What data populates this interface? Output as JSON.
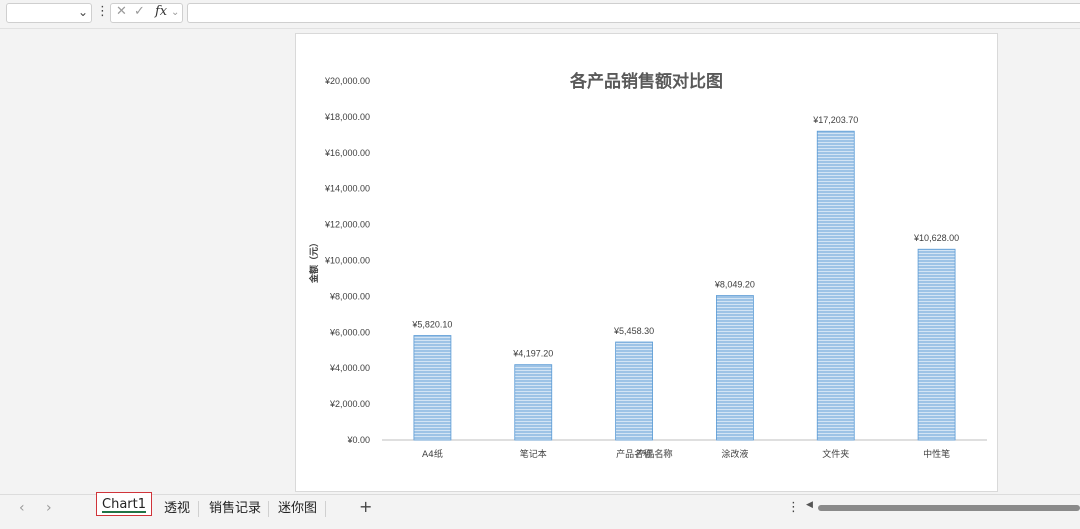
{
  "formula_bar": {
    "name_box_value": "",
    "formula_value": "",
    "fx_label": "fx"
  },
  "chart_data": {
    "type": "bar",
    "title": "各产品销售额对比图",
    "xlabel": "产品名称",
    "ylabel": "金额（元）",
    "categories": [
      "A4纸",
      "笔记本",
      "产品名称",
      "涂改液",
      "文件夹",
      "中性笔"
    ],
    "values": [
      5820.1,
      4197.2,
      5458.3,
      8049.2,
      17203.7,
      10628.0
    ],
    "value_labels": [
      "¥5,820.10",
      "¥4,197.20",
      "¥5,458.30",
      "¥8,049.20",
      "¥17,203.70",
      "¥10,628.00"
    ],
    "ylim": [
      0,
      20000
    ],
    "y_ticks": [
      0,
      2000,
      4000,
      6000,
      8000,
      10000,
      12000,
      14000,
      16000,
      18000,
      20000
    ],
    "y_tick_labels": [
      "¥0.00",
      "¥2,000.00",
      "¥4,000.00",
      "¥6,000.00",
      "¥8,000.00",
      "¥10,000.00",
      "¥12,000.00",
      "¥14,000.00",
      "¥16,000.00",
      "¥18,000.00",
      "¥20,000.00"
    ],
    "grid": false,
    "bar_color": "#9dc3e6",
    "bar_stroke": "#5b9bd5"
  },
  "sheet_tabs": [
    {
      "label": "Chart1",
      "active": true
    },
    {
      "label": "透视",
      "active": false
    },
    {
      "label": "销售记录",
      "active": false
    },
    {
      "label": "迷你图",
      "active": false
    }
  ],
  "colors": {
    "active_tab_border": "#d0343a",
    "active_tab_underline": "#217346"
  }
}
